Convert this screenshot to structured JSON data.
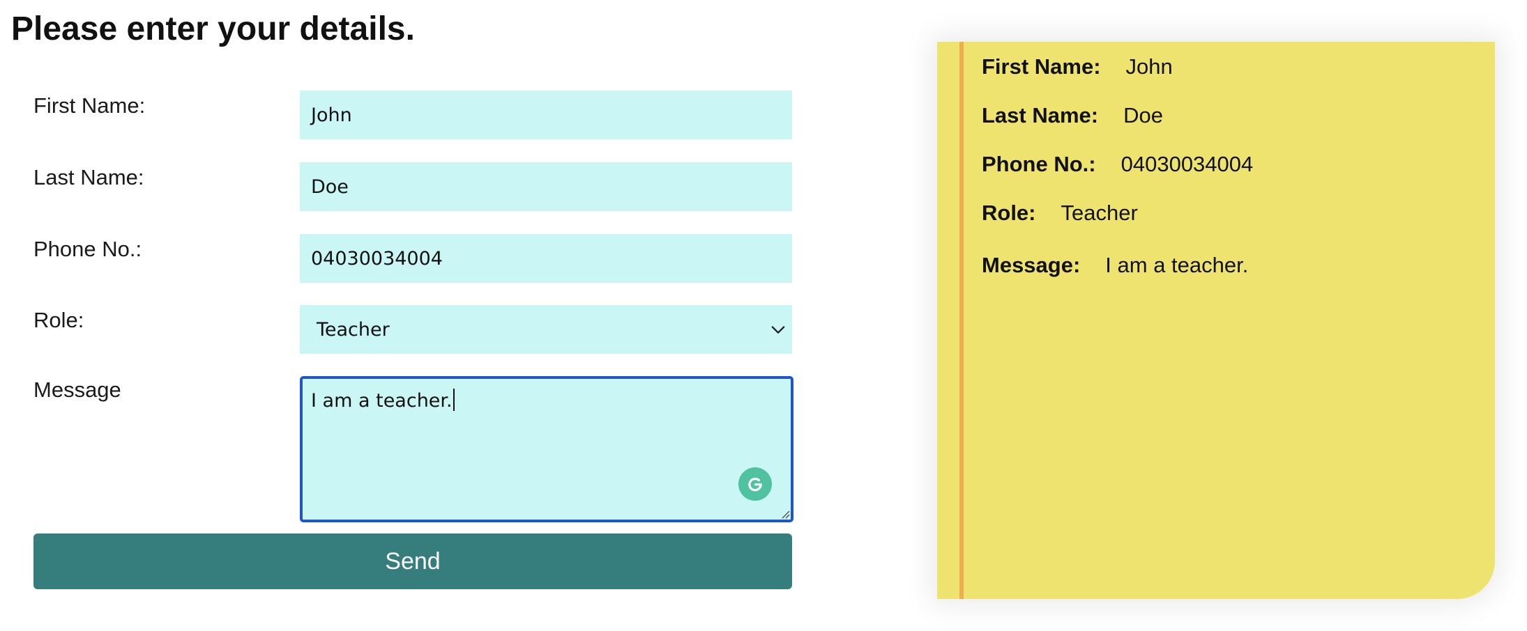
{
  "page": {
    "title": "Please enter your details."
  },
  "form": {
    "first_name": {
      "label": "First Name:",
      "value": "John"
    },
    "last_name": {
      "label": "Last Name:",
      "value": "Doe"
    },
    "phone": {
      "label": "Phone No.:",
      "value": "04030034004"
    },
    "role": {
      "label": "Role:",
      "selected": "Teacher"
    },
    "message": {
      "label": "Message",
      "value": "I am a teacher."
    },
    "send_label": "Send"
  },
  "preview": {
    "first_name": {
      "label": "First Name:",
      "value": "John"
    },
    "last_name": {
      "label": "Last Name:",
      "value": "Doe"
    },
    "phone": {
      "label": "Phone No.:",
      "value": "04030034004"
    },
    "role": {
      "label": "Role:",
      "value": "Teacher"
    },
    "message": {
      "label": "Message:",
      "value": "I am a teacher."
    }
  },
  "icons": {
    "select_arrow": "chevron-down-icon",
    "writing_assistant": "grammarly-icon",
    "textarea_resize": "resize-handle-icon"
  },
  "colors": {
    "field_bg": "#cbf6f6",
    "focus_border": "#1f57c7",
    "button_bg": "#367e7e",
    "note_bg": "#efe370",
    "note_margin": "#eeae4f",
    "grammarly": "#4fc29f"
  }
}
